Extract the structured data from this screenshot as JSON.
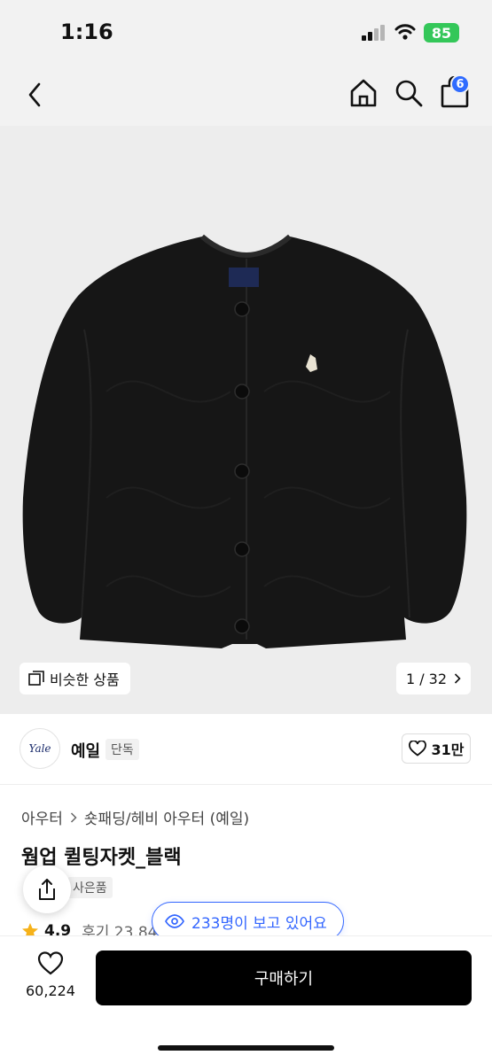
{
  "status_bar": {
    "time": "1:16",
    "battery": "85"
  },
  "nav": {
    "cart_count": "6"
  },
  "gallery": {
    "similar_label": "비슷한 상품",
    "page_counter": "1 / 32"
  },
  "brand": {
    "logo_text": "Yale",
    "name": "예일",
    "exclusive_label": "단독",
    "likes": "31만"
  },
  "breadcrumb": [
    "아우터",
    "숏패딩/헤비 아우터 (예일)"
  ],
  "product": {
    "title": "웜업 퀼팅자켓_블랙",
    "gift_label": "사은품",
    "rating": "4.9",
    "review_label": "후기 23,845",
    "viewers_label": "233명이 보고 있어요"
  },
  "bottom": {
    "wish_count": "60,224",
    "buy_label": "구매하기"
  },
  "colors": {
    "accent": "#3366ff",
    "badge": "#2f6bff",
    "battery": "#34c759",
    "star": "#f6b21a"
  }
}
